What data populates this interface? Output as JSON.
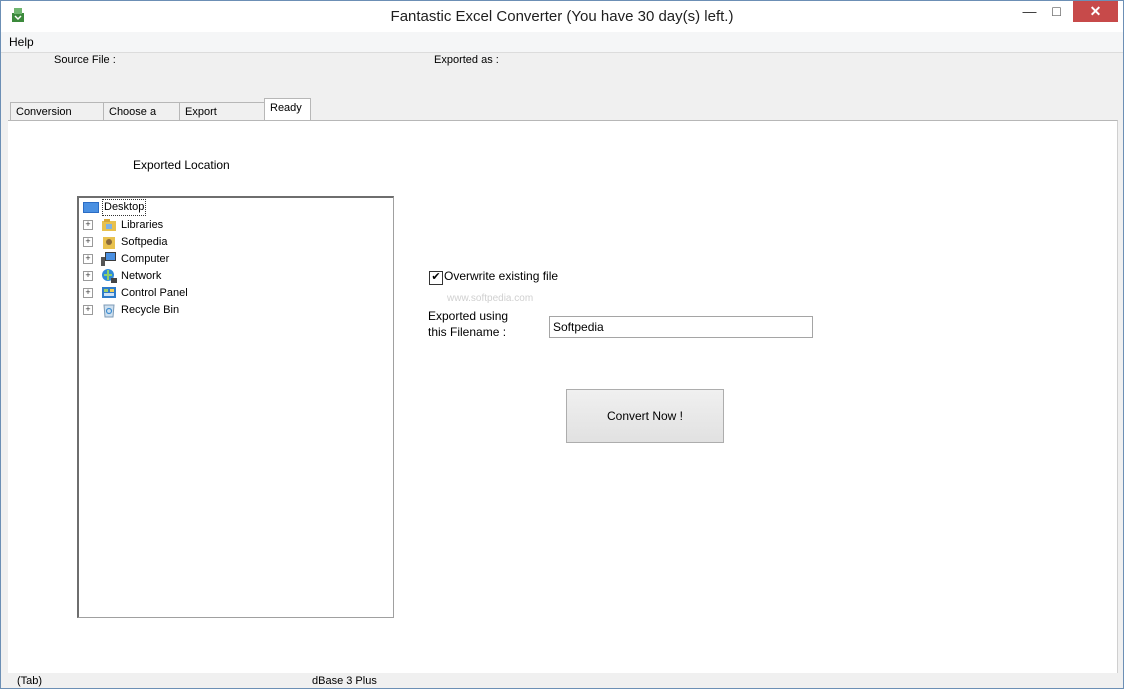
{
  "window": {
    "title": "Fantastic Excel Converter  (You have 30 day(s) left.)",
    "minimize_glyph": "—",
    "maximize_glyph": "□",
    "close_glyph": "✕"
  },
  "menu": {
    "help": "Help"
  },
  "info": {
    "source_file_label": "Source File :",
    "exported_as_label": "Exported as :"
  },
  "tabs": [
    {
      "label": "Conversion Type",
      "active": false
    },
    {
      "label": "Choose a File",
      "active": false
    },
    {
      "label": "Export Settings",
      "active": false
    },
    {
      "label": "Ready",
      "active": true
    }
  ],
  "export": {
    "location_label": "Exported  Location",
    "tree": [
      {
        "label": "Desktop",
        "icon": "desktop-icon",
        "selected": true
      },
      {
        "label": "Libraries",
        "icon": "libraries-icon"
      },
      {
        "label": "Softpedia",
        "icon": "user-folder-icon"
      },
      {
        "label": "Computer",
        "icon": "computer-icon"
      },
      {
        "label": "Network",
        "icon": "network-icon"
      },
      {
        "label": "Control Panel",
        "icon": "control-panel-icon"
      },
      {
        "label": "Recycle Bin",
        "icon": "recycle-bin-icon"
      }
    ],
    "overwrite_label": "Overwrite existing file",
    "overwrite_checked": true,
    "watermark": "www.softpedia.com",
    "filename_label_line1": "Exported using",
    "filename_label_line2": "this Filename :",
    "filename_value": "Softpedia",
    "convert_label": "Convert Now !"
  },
  "status": {
    "left": "(Tab)",
    "middle": "dBase 3 Plus"
  }
}
